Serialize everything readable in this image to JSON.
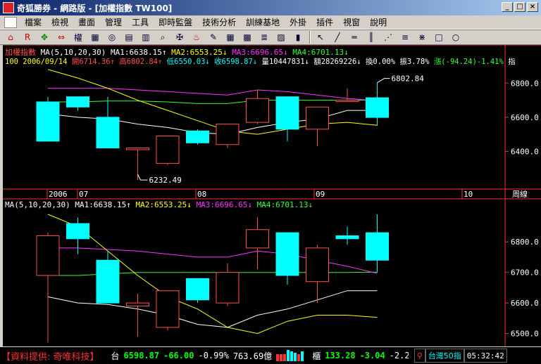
{
  "window": {
    "title": "奇狐勝券 - 網路版 - [加權指數 TW100]"
  },
  "menu": [
    "檔案",
    "檢視",
    "畫面",
    "管理",
    "工具",
    "即時監盤",
    "技術分析",
    "訓練基地",
    "外掛",
    "插件",
    "視窗",
    "說明"
  ],
  "toolbar": {
    "icons": [
      "home-icon",
      "rsi-icon",
      "move-icon",
      "arrows-icon",
      "weight-icon",
      "pattern-icon",
      "binoculars-icon",
      "books-icon",
      "cards-icon",
      "magnifier-icon",
      "tools-icon",
      "alarm-icon",
      "pen-icon",
      "table-icon",
      "grid-icon",
      "list-icon",
      "chart-icon",
      "bars-icon",
      "pointer-icon",
      "trend-line-icon",
      "h-line-icon",
      "v-lines-icon",
      "fan-icon",
      "channel-icon",
      "gann-icon",
      "rect-icon",
      "circle-icon"
    ],
    "weight_label": "權"
  },
  "colors": {
    "up": "#ff5050",
    "down": "#00ffff",
    "ma1": "#ffffff",
    "ma2": "#ffff00",
    "ma3": "#ff33ff",
    "ma4": "#33ff33",
    "axis": "#ff3030",
    "text": "#ffffff"
  },
  "top_panel": {
    "index_name": "加權指數",
    "ma_params": "MA(5,10,20,30)",
    "ma1": "MA1:6638.15↑",
    "ma2": "MA2:6553.25↓",
    "ma3": "MA3:6696.65↓",
    "ma4": "MA4:6701.13↓",
    "quote": {
      "period": "100",
      "date": "2006/09/14",
      "open": "開6714.36↑",
      "high": "高6802.84↑",
      "low": "低6550.03↓",
      "close": "收6598.87↓",
      "volume": "量10447831↓",
      "amount": "額28269226↓",
      "turnover": "換0.00%",
      "amplitude": "振3.78%",
      "change": "漲(-94.24)-1.41%",
      "tail": "指"
    },
    "y_ticks": [
      "6800.0",
      "6600.0",
      "6400.0"
    ],
    "high_label": "6802.84",
    "low_label": "6232.49"
  },
  "date_axis": {
    "labels": [
      "2006",
      "07",
      "08",
      "09",
      "10"
    ],
    "period_label": "周線"
  },
  "bottom_panel": {
    "ma_params": "MA(5,10,20,30)",
    "ma1": "MA1:6638.15↑",
    "ma2": "MA2:6553.25↓",
    "ma3": "MA3:6696.65↓",
    "ma4": "MA4:6701.13↓",
    "y_ticks": [
      "6800.0",
      "6700.0",
      "6600.0",
      "6500.0"
    ]
  },
  "chart_data": {
    "type": "candlestick",
    "top": {
      "candles": [
        {
          "o": 6690,
          "h": 6720,
          "l": 6460,
          "c": 6460
        },
        {
          "o": 6720,
          "h": 6720,
          "l": 6640,
          "c": 6660
        },
        {
          "o": 6600,
          "h": 6720,
          "l": 6420,
          "c": 6420
        },
        {
          "o": 6410,
          "h": 6420,
          "l": 6232.49,
          "c": 6420
        },
        {
          "o": 6330,
          "h": 6480,
          "l": 6320,
          "c": 6490
        },
        {
          "o": 6520,
          "h": 6530,
          "l": 6440,
          "c": 6450
        },
        {
          "o": 6440,
          "h": 6560,
          "l": 6420,
          "c": 6560
        },
        {
          "o": 6570,
          "h": 6760,
          "l": 6560,
          "c": 6710
        },
        {
          "o": 6720,
          "h": 6720,
          "l": 6460,
          "c": 6530
        },
        {
          "o": 6530,
          "h": 6660,
          "l": 6430,
          "c": 6660
        },
        {
          "o": 6700,
          "h": 6770,
          "l": 6700,
          "c": 6700
        },
        {
          "o": 6714.36,
          "h": 6802.84,
          "l": 6550.03,
          "c": 6598.87
        }
      ],
      "ma1": [
        6620,
        6600,
        6590,
        6560,
        6540,
        6510,
        6500,
        6540,
        6570,
        6590,
        6640,
        6640
      ],
      "ma2": [
        6880,
        6830,
        6770,
        6700,
        6640,
        6580,
        6520,
        6500,
        6530,
        6560,
        6570,
        6553
      ],
      "ma3": [
        6770,
        6770,
        6770,
        6760,
        6750,
        6740,
        6730,
        6760,
        6750,
        6730,
        6710,
        6697
      ],
      "ma4": [
        6690,
        6690,
        6695,
        6695,
        6690,
        6680,
        6680,
        6700,
        6700,
        6700,
        6700,
        6701
      ]
    },
    "bottom": {
      "candles": [
        {
          "o": 6690,
          "h": 6830,
          "l": 6470,
          "c": 6820
        },
        {
          "o": 6860,
          "h": 6880,
          "l": 6760,
          "c": 6810
        },
        {
          "o": 6740,
          "h": 6770,
          "l": 6600,
          "c": 6600
        },
        {
          "o": 6590,
          "h": 6630,
          "l": 6490,
          "c": 6600
        },
        {
          "o": 6520,
          "h": 6640,
          "l": 6510,
          "c": 6640
        },
        {
          "o": 6680,
          "h": 6680,
          "l": 6600,
          "c": 6610
        },
        {
          "o": 6600,
          "h": 6730,
          "l": 6590,
          "c": 6700
        },
        {
          "o": 6780,
          "h": 6880,
          "l": 6710,
          "c": 6840
        },
        {
          "o": 6830,
          "h": 6830,
          "l": 6660,
          "c": 6690
        },
        {
          "o": 6670,
          "h": 6790,
          "l": 6600,
          "c": 6780
        },
        {
          "o": 6820,
          "h": 6850,
          "l": 6790,
          "c": 6810
        },
        {
          "o": 6830,
          "h": 6890,
          "l": 6700,
          "c": 6740
        }
      ],
      "ma1": [
        6620,
        6600,
        6595,
        6580,
        6560,
        6530,
        6520,
        6560,
        6580,
        6610,
        6640,
        6640
      ],
      "ma2": [
        6890,
        6850,
        6770,
        6690,
        6620,
        6580,
        6520,
        6500,
        6540,
        6560,
        6560,
        6553
      ],
      "ma3": [
        6780,
        6780,
        6775,
        6770,
        6760,
        6750,
        6750,
        6770,
        6760,
        6740,
        6720,
        6697
      ],
      "ma4": [
        6690,
        6690,
        6695,
        6700,
        6700,
        6700,
        6700,
        6700,
        6700,
        6700,
        6700,
        6701
      ]
    }
  },
  "statusbar": {
    "provider": "【資料提供: 奇唯科技】",
    "tai_label": "台",
    "tai_index": "6598.87",
    "tai_change": "-66.00",
    "tai_pct": "-0.99%",
    "tai_amount": "763.69億",
    "otc_label": "櫃",
    "otc_index": "133.28",
    "otc_change": "-3.04",
    "otc_pct": "-2.23",
    "tw50": "台灣50指",
    "time": "05:32:42"
  }
}
